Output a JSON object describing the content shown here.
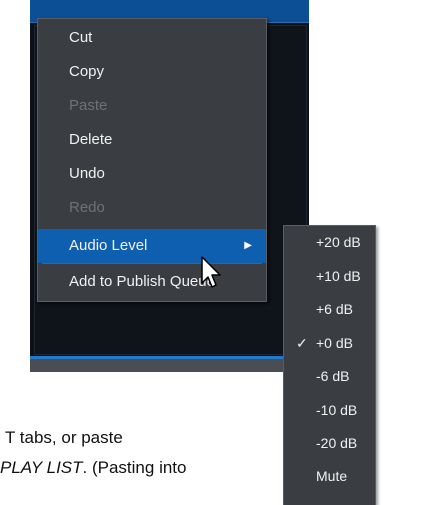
{
  "context_menu": {
    "items": [
      {
        "label": "Cut",
        "enabled": true
      },
      {
        "label": "Copy",
        "enabled": true
      },
      {
        "label": "Paste",
        "enabled": false
      },
      {
        "label": "Delete",
        "enabled": true
      },
      {
        "label": "Undo",
        "enabled": true
      },
      {
        "label": "Redo",
        "enabled": false
      },
      {
        "label": "Audio Level",
        "enabled": true,
        "highlighted": true,
        "has_submenu": true
      },
      {
        "label": "Add to Publish Queue",
        "enabled": true
      }
    ],
    "submenu_arrow_icon": "caret-right-icon"
  },
  "audio_level_submenu": {
    "items": [
      {
        "label": "+20 dB",
        "checked": false
      },
      {
        "label": "+10 dB",
        "checked": false
      },
      {
        "label": "+6 dB",
        "checked": false
      },
      {
        "label": "+0 dB",
        "checked": true
      },
      {
        "label": "-6 dB",
        "checked": false
      },
      {
        "label": "-10 dB",
        "checked": false
      },
      {
        "label": "-20 dB",
        "checked": false
      },
      {
        "label": "Mute",
        "checked": false
      }
    ],
    "check_mark": "✓"
  },
  "document_text": {
    "line1_prefix": "T",
    "line1_rest": " tabs, or paste",
    "line2_italic": "PLAY LIST",
    "line2_rest": ".  (Pasting into"
  },
  "colors": {
    "menu_bg": "#3a3d42",
    "highlight": "#0f5fb0",
    "app_bg": "#0d1117",
    "title_bar": "#0c4f95"
  },
  "cursor_icon": "arrow-pointer-icon"
}
